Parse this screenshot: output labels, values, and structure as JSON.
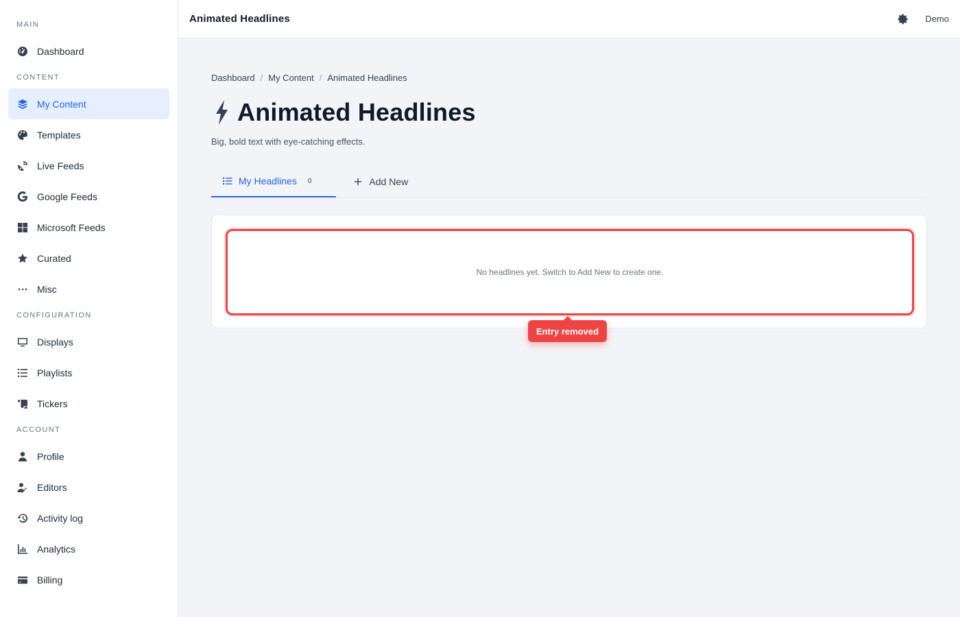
{
  "sidebar": {
    "sections": [
      {
        "label": "MAIN",
        "items": [
          {
            "label": "Dashboard",
            "icon": "gauge-icon"
          }
        ]
      },
      {
        "label": "CONTENT",
        "items": [
          {
            "label": "My Content",
            "icon": "layers-icon",
            "active": true
          },
          {
            "label": "Templates",
            "icon": "palette-icon"
          },
          {
            "label": "Live Feeds",
            "icon": "satellite-dish-icon"
          },
          {
            "label": "Google Feeds",
            "icon": "google-icon"
          },
          {
            "label": "Microsoft Feeds",
            "icon": "windows-icon"
          },
          {
            "label": "Curated",
            "icon": "star-icon"
          },
          {
            "label": "Misc",
            "icon": "ellipsis-icon"
          }
        ]
      },
      {
        "label": "CONFIGURATION",
        "items": [
          {
            "label": "Displays",
            "icon": "monitor-icon"
          },
          {
            "label": "Playlists",
            "icon": "list-icon"
          },
          {
            "label": "Tickers",
            "icon": "scroll-icon"
          }
        ]
      },
      {
        "label": "ACCOUNT",
        "items": [
          {
            "label": "Profile",
            "icon": "user-icon"
          },
          {
            "label": "Editors",
            "icon": "user-pen-icon"
          },
          {
            "label": "Activity log",
            "icon": "history-icon"
          },
          {
            "label": "Analytics",
            "icon": "chart-icon"
          },
          {
            "label": "Billing",
            "icon": "credit-card-icon"
          }
        ]
      }
    ]
  },
  "topbar": {
    "title": "Animated Headlines",
    "user": "Demo"
  },
  "breadcrumb": {
    "items": [
      "Dashboard",
      "My Content",
      "Animated Headlines"
    ],
    "sep": "/"
  },
  "page": {
    "title": "Animated Headlines",
    "subtitle": "Big, bold text with eye-catching effects."
  },
  "tabs": {
    "list_label": "My Headlines",
    "list_count": "0",
    "add_label": "Add New"
  },
  "empty": {
    "message": "No headlines yet. Switch to Add New to create one."
  },
  "toast": {
    "message": "Entry removed"
  },
  "colors": {
    "accent": "#2563eb",
    "danger": "#ef4444"
  }
}
